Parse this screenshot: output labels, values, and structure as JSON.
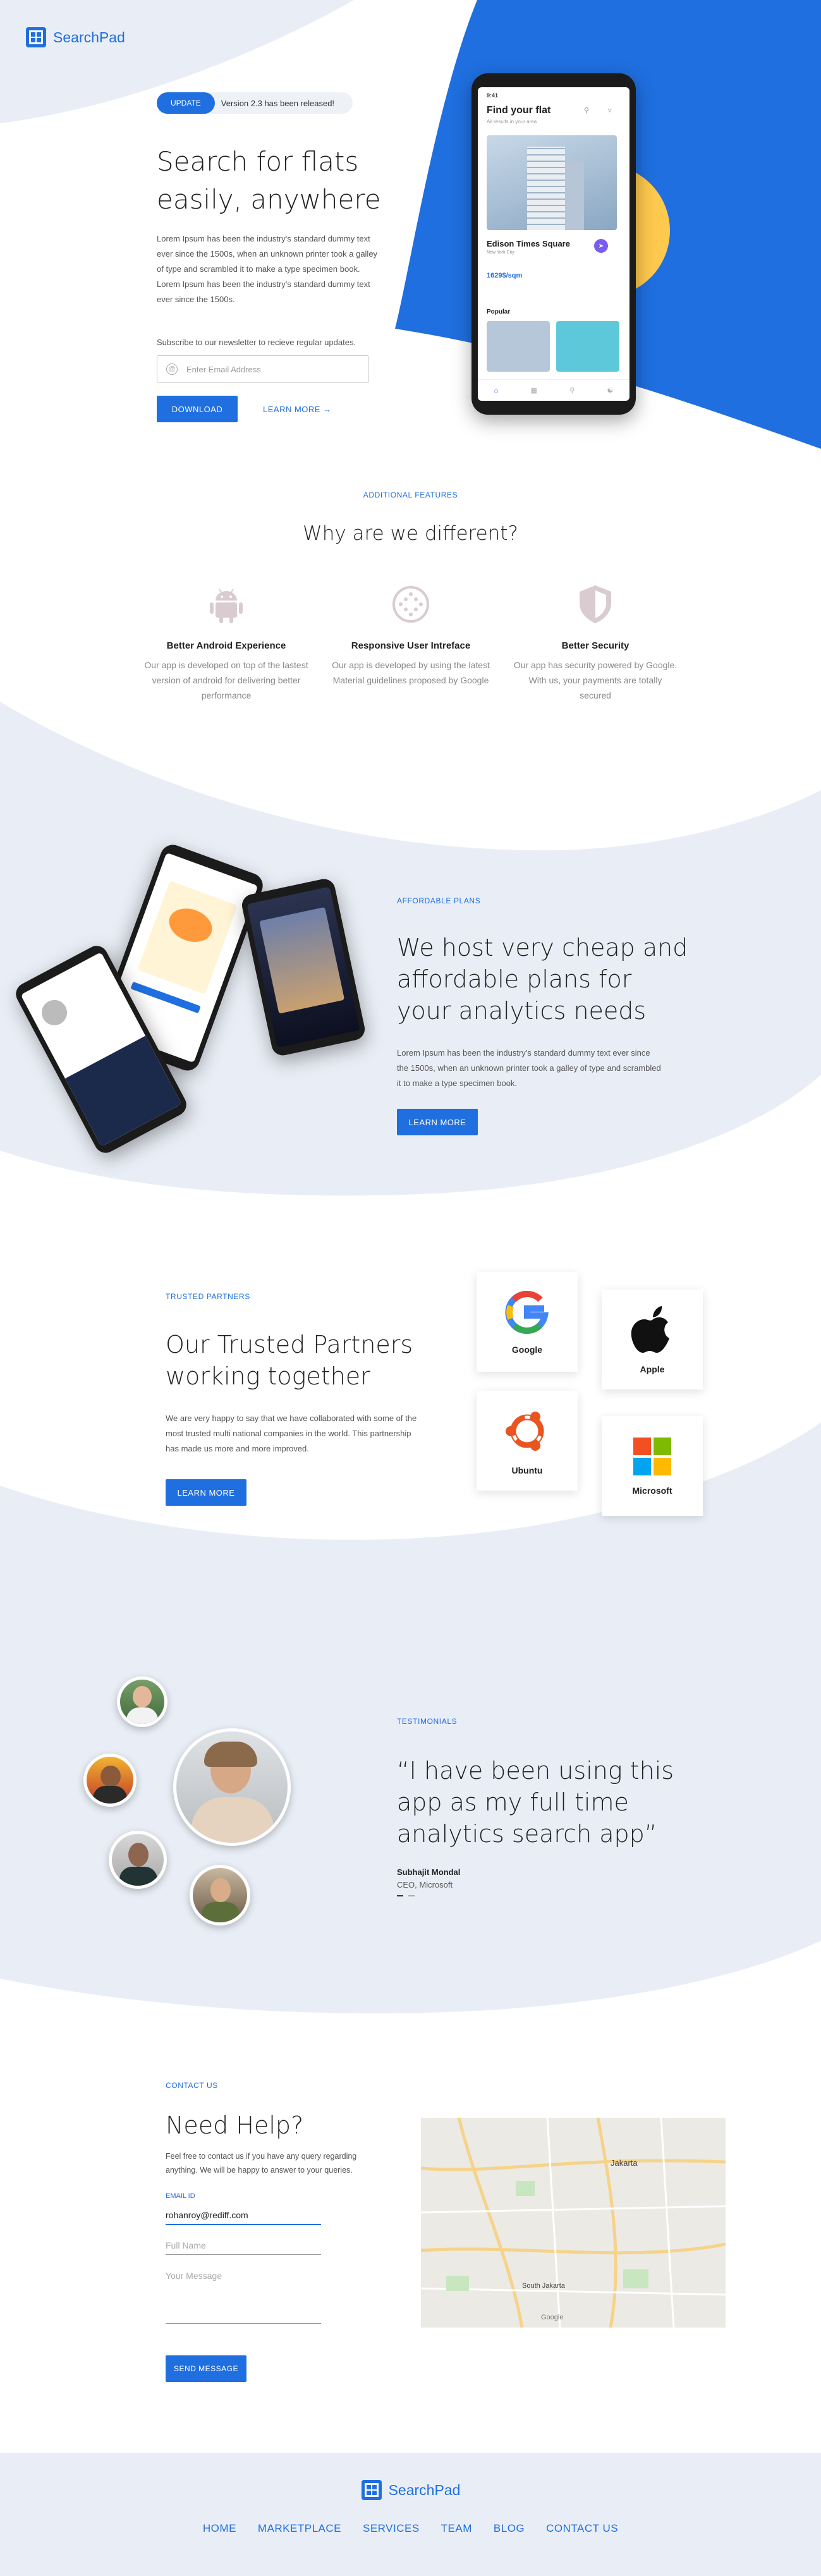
{
  "brand": {
    "name": "SearchPad"
  },
  "hero": {
    "badge": "UPDATE",
    "badge_text": "Version 2.3 has been released!",
    "title_line1": "Search for flats",
    "title_line2": "easily, anywhere",
    "body": "Lorem Ipsum has been the industry's standard dummy text ever since the 1500s, when an unknown printer took a galley of type and scrambled it to make a type specimen book. Lorem Ipsum has been the industry's standard dummy text ever since the 1500s.",
    "subscribe_text": "Subscribe to our newsletter to recieve regular updates.",
    "email_placeholder": "Enter Email Address",
    "download_label": "DOWNLOAD",
    "learn_more_label": "LEARN MORE →"
  },
  "phone_app": {
    "time": "9:41",
    "title": "Find your flat",
    "subtitle": "All results in your area",
    "listing_name": "Edison Times Square",
    "listing_loc": "New York City",
    "listing_price": "1629$/sqm",
    "section": "Popular"
  },
  "features": {
    "eyebrow": "ADDITIONAL FEATURES",
    "title": "Why are we different?",
    "items": [
      {
        "icon": "android-icon",
        "title": "Better Android Experience",
        "desc": "Our app is developed on top of the lastest version of android for delivering better performance"
      },
      {
        "icon": "dots-grid-icon",
        "title": "Responsive User Intreface",
        "desc": "Our app is developed by using the latest Material guidelines proposed by Google"
      },
      {
        "icon": "shield-icon",
        "title": "Better Security",
        "desc": "Our app has security powered by Google. With us, your payments are totally secured"
      }
    ]
  },
  "plans": {
    "eyebrow": "AFFORDABLE PLANS",
    "title_line1": "We host very cheap and",
    "title_line2": "affordable plans for",
    "title_line3": "your analytics needs",
    "body": "Lorem Ipsum has been the industry's standard dummy text ever since the 1500s, when an unknown printer took a galley of type and scrambled it to make a type specimen book.",
    "button": "LEARN MORE"
  },
  "partners": {
    "eyebrow": "TRUSTED PARTNERS",
    "title_line1": "Our Trusted Partners",
    "title_line2": "working together",
    "body": "We are very happy to say that we have collaborated with some of the most trusted multi national companies in the world. This partnership has made us more and more improved.",
    "button": "LEARN MORE",
    "items": [
      {
        "name": "Google",
        "icon": "google-logo-icon"
      },
      {
        "name": "Apple",
        "icon": "apple-logo-icon"
      },
      {
        "name": "Ubuntu",
        "icon": "ubuntu-logo-icon"
      },
      {
        "name": "Microsoft",
        "icon": "microsoft-logo-icon"
      }
    ]
  },
  "testimonials": {
    "eyebrow": "TESTIMONIALS",
    "quote_line1": "“I have been using this",
    "quote_line2": "app as my full time",
    "quote_line3": "analytics search app”",
    "author": "Subhajit Mondal",
    "role": "CEO, Microsoft",
    "pager_total": 2,
    "pager_active": 1
  },
  "contact": {
    "eyebrow": "CONTACT US",
    "title": "Need Help?",
    "body": "Feel free to contact us if you have any query regarding anything. We will be happy to answer to your queries.",
    "email_label": "EMAIL ID",
    "email_value": "rohanroy@rediff.com",
    "name_placeholder": "Full Name",
    "message_placeholder": "Your Message",
    "button": "SEND MESSAGE"
  },
  "map": {
    "label_jakarta": "Jakarta",
    "label_south": "South Jakarta",
    "label_google": "Google"
  },
  "footer": {
    "nav": [
      "HOME",
      "MARKETPLACE",
      "SERVICES",
      "TEAM",
      "BLOG",
      "CONTACT US"
    ]
  },
  "colors": {
    "accent": "#1f6fe0",
    "hero_yellow": "#ffc94d",
    "wave_bg": "#e9eef6"
  }
}
